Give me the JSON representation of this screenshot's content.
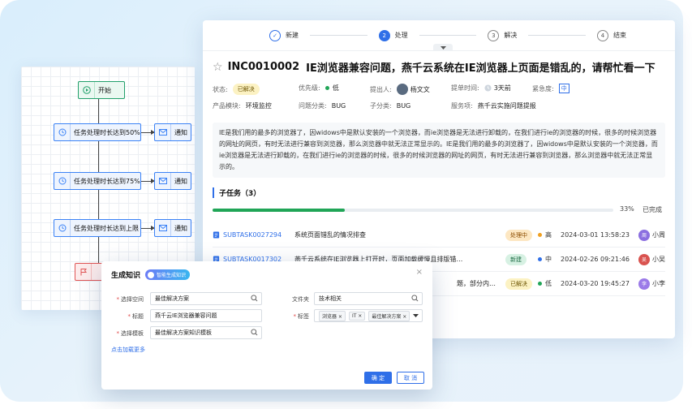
{
  "flow": {
    "start": "开始",
    "nodes": [
      "任务处理时长达到50%",
      "任务处理时长达到75%",
      "任务处理时长达到上限"
    ],
    "notify": "通知"
  },
  "steps": [
    {
      "num": "✓",
      "label": "新建",
      "state": "done"
    },
    {
      "num": "2",
      "label": "处理",
      "state": "active"
    },
    {
      "num": "3",
      "label": "解决",
      "state": "todo"
    },
    {
      "num": "4",
      "label": "结束",
      "state": "todo"
    }
  ],
  "ticket": {
    "id": "INC0010002",
    "title": "IE浏览器兼容问题，燕千云系统在IE浏览器上页面是错乱的，请帮忙看一下",
    "status_label": "状态:",
    "status": "已解决",
    "priority_label": "优先级:",
    "priority": "低",
    "reporter_label": "提出人:",
    "reporter": "杨文文",
    "time_label": "提单时间:",
    "time": "3天前",
    "urgency_label": "紧急度:",
    "urgency": "中",
    "module_label": "产品模块:",
    "module": "环境监控",
    "category_label": "问题分类:",
    "category": "BUG",
    "subtype_label": "子分类:",
    "subtype": "BUG",
    "service_label": "服务项:",
    "service": "燕千云实施问题提报",
    "description": "IE是我们用的最多的浏览器了，因widows中是默认安装的一个浏览器，而ie浏览器是无法进行卸载的，在我们进行ie的浏览器的时候，很多的时候浏览器的网址的网页，有时无法进行兼容到浏览器，那么浏览器中就无法正常显示的。IE是我们用的最多的浏览器了，因widows中是默认安装的一个浏览器，而ie浏览器是无法进行卸载的，在我们进行ie的浏览器的时候，很多的时候浏览器的网址的网页，有时无法进行兼容到浏览器，那么浏览器中就无法正常显示的。"
  },
  "subtasks": {
    "heading": "子任务（3）",
    "progress": 33,
    "progress_text": "33%",
    "done_text": "已完成",
    "rows": [
      {
        "code": "SUBTASK0027294",
        "name": "系统页面错乱的情况排查",
        "status": "处理中",
        "status_kind": "processing",
        "priority": "高",
        "prio_color": "#f0a020",
        "time": "2024-03-01 13:58:23",
        "user": "小周",
        "avatar": "周",
        "avatar_color": "#8b6fe0"
      },
      {
        "code": "SUBTASK0017302",
        "name": "燕千云系统在IE浏览器上打开时，页面加载缓慢且排版错…",
        "status": "新建",
        "status_kind": "new",
        "priority": "中",
        "prio_color": "#2f6fe8",
        "time": "2024-02-26 09:21:46",
        "user": "小吴",
        "avatar": "吴",
        "avatar_color": "#d9534f"
      },
      {
        "code": "",
        "name": "题，部分内…",
        "status": "已解决",
        "status_kind": "ok",
        "priority": "低",
        "prio_color": "#20a557",
        "time": "2024-03-20 19:45:27",
        "user": "小李",
        "avatar": "李",
        "avatar_color": "#9b7ae8"
      }
    ]
  },
  "dialog": {
    "title": "生成知识",
    "ai_badge": "智能生成知识",
    "space_label": "选择空间",
    "space_value": "最佳解决方案",
    "folder_label": "文件夹",
    "folder_value": "技术相关",
    "title_label": "标题",
    "title_value": "燕千云IE浏览器兼容问题",
    "tags_label": "标签",
    "tags": [
      "浏览器",
      "IT",
      "最佳解决方案"
    ],
    "template_label": "选择模板",
    "template_value": "最佳解决方案知识模板",
    "more_link": "点击加载更多",
    "ok": "确 定",
    "cancel": "取 消"
  }
}
